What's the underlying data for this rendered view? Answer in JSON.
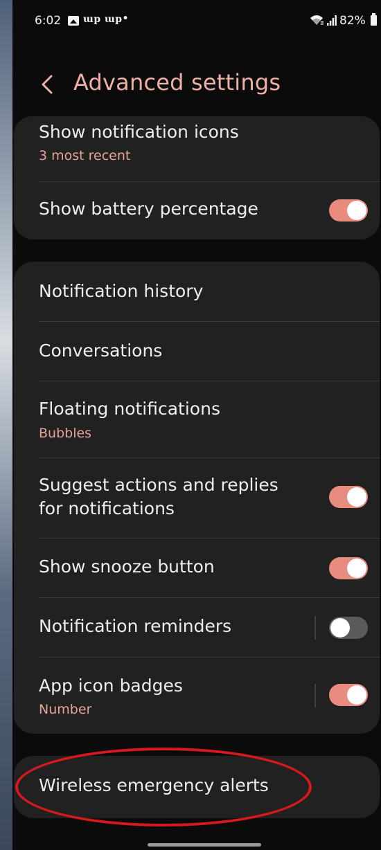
{
  "status_bar": {
    "time": "6:02",
    "app_icons": "ɯp ɯp",
    "dot": "•",
    "battery": "82%"
  },
  "header": {
    "title": "Advanced settings",
    "back_icon": "chevron-left-icon"
  },
  "sections": [
    {
      "items": [
        {
          "label": "Show notification icons",
          "sub": "3 most recent"
        },
        {
          "label": "Show battery percentage",
          "toggle": true
        }
      ]
    },
    {
      "items": [
        {
          "label": "Notification history"
        },
        {
          "label": "Conversations"
        },
        {
          "label": "Floating notifications",
          "sub": "Bubbles"
        },
        {
          "label_line1": "Suggest actions and replies",
          "label_line2": "for notifications",
          "toggle": true
        },
        {
          "label": "Show snooze button",
          "toggle": true
        },
        {
          "label": "Notification reminders",
          "toggle": false
        },
        {
          "label": "App icon badges",
          "sub": "Number",
          "toggle": true
        }
      ]
    },
    {
      "items": [
        {
          "label": "Wireless emergency alerts"
        }
      ]
    }
  ],
  "colors": {
    "accent": "#efb0a6",
    "toggle_on": "#e98c80",
    "highlight": "#d6191c",
    "card": "#212121",
    "background": "#0b0b0b"
  }
}
